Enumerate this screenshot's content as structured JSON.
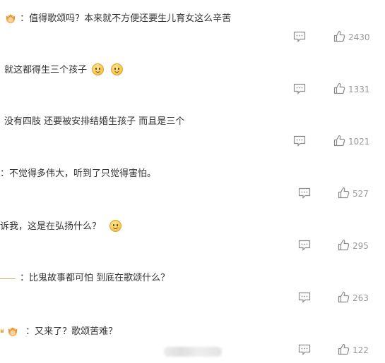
{
  "comments": [
    {
      "text": "：值得歌颂吗？本来就不方便还要生儿育女这么辛苦",
      "likes": "2430"
    },
    {
      "text": "就这都得生三个孩子",
      "likes": "1331"
    },
    {
      "text": "没有四肢 还要被安排结婚生孩子 而且是三个",
      "likes": "1021"
    },
    {
      "text": "：不觉得多伟大，听到了只觉得害怕。",
      "likes": "527"
    },
    {
      "text": "诉我，这是在弘扬什么？",
      "likes": "295"
    },
    {
      "text": "：比鬼故事都可怕 到底在歌颂什么？",
      "likes": "263"
    },
    {
      "text": "：又来了？歌颂苦难？",
      "likes": "122"
    }
  ],
  "colors": {
    "text": "#333333",
    "meta": "#999999",
    "icon": "#8a8a8a"
  },
  "icons": {
    "reply": "comment-icon",
    "like": "thumbs-up-icon",
    "badge": "crown-badge-icon",
    "emoji": "smile-emoji-icon"
  }
}
